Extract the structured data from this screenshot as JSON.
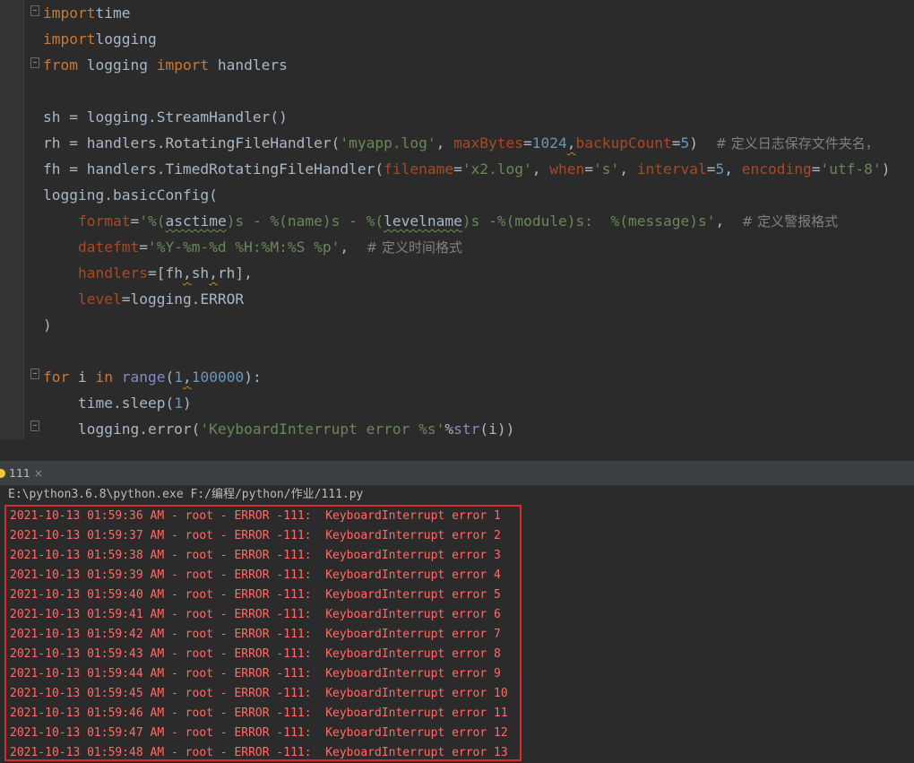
{
  "editor": {
    "code": [
      [
        [
          "kw",
          "import"
        ],
        [
          "",
          "time"
        ]
      ],
      [
        [
          "kw",
          "import"
        ],
        [
          "",
          "logging"
        ]
      ],
      [
        [
          "kw",
          "from"
        ],
        [
          "",
          " logging "
        ],
        [
          "kw",
          "import"
        ],
        [
          "",
          " handlers"
        ]
      ],
      [],
      [
        [
          "",
          "sh = logging.StreamHandler()"
        ]
      ],
      [
        [
          "",
          "rh = handlers.RotatingFileHandler("
        ],
        [
          "str",
          "'myapp.log'"
        ],
        [
          "",
          ", "
        ],
        [
          "param",
          "maxBytes"
        ],
        [
          "",
          "="
        ],
        [
          "num",
          "1024"
        ],
        [
          "warn",
          ","
        ],
        [
          "param",
          "backupCount"
        ],
        [
          "",
          "="
        ],
        [
          "num",
          "5"
        ],
        [
          "",
          ")  "
        ],
        [
          "cmt",
          "# 定义日志保存文件夹名，"
        ]
      ],
      [
        [
          "",
          "fh = handlers.TimedRotatingFileHandler("
        ],
        [
          "param",
          "filename"
        ],
        [
          "",
          "="
        ],
        [
          "str",
          "'x2.log'"
        ],
        [
          "",
          ", "
        ],
        [
          "param",
          "when"
        ],
        [
          "",
          "="
        ],
        [
          "str",
          "'s'"
        ],
        [
          "",
          ", "
        ],
        [
          "param",
          "interval"
        ],
        [
          "",
          "="
        ],
        [
          "num",
          "5"
        ],
        [
          "",
          ", "
        ],
        [
          "param",
          "encoding"
        ],
        [
          "",
          "="
        ],
        [
          "str",
          "'utf-8'"
        ],
        [
          "",
          ")"
        ]
      ],
      [
        [
          "",
          "logging.basicConfig("
        ]
      ],
      [
        [
          "",
          "    "
        ],
        [
          "param",
          "format"
        ],
        [
          "",
          "="
        ],
        [
          "str",
          "'%("
        ],
        [
          "wavy",
          "asctime"
        ],
        [
          "str",
          ")s - %(name)s - %("
        ],
        [
          "wavy",
          "levelname"
        ],
        [
          "str",
          ")s -%(module)s:  %(message)s'"
        ],
        [
          "",
          ",  "
        ],
        [
          "cmt",
          "# 定义警报格式"
        ]
      ],
      [
        [
          "",
          "    "
        ],
        [
          "param",
          "datefmt"
        ],
        [
          "",
          "="
        ],
        [
          "str",
          "'%Y-%m-%d %H:%M:%S %p'"
        ],
        [
          "",
          ",  "
        ],
        [
          "cmt",
          "# 定义时间格式"
        ]
      ],
      [
        [
          "",
          "    "
        ],
        [
          "param",
          "handlers"
        ],
        [
          "",
          "=[fh"
        ],
        [
          "warn",
          ","
        ],
        [
          "",
          "sh"
        ],
        [
          "warn",
          ","
        ],
        [
          "",
          "rh],"
        ]
      ],
      [
        [
          "",
          "    "
        ],
        [
          "param",
          "level"
        ],
        [
          "",
          "=logging.ERROR"
        ]
      ],
      [
        [
          "",
          ")"
        ]
      ],
      [],
      [
        [
          "kw",
          "for"
        ],
        [
          "",
          " i "
        ],
        [
          "kw",
          "in"
        ],
        [
          "",
          " "
        ],
        [
          "bi",
          "range"
        ],
        [
          "",
          "("
        ],
        [
          "num",
          "1"
        ],
        [
          "warn",
          ","
        ],
        [
          "num",
          "100000"
        ],
        [
          "",
          "):"
        ]
      ],
      [
        [
          "",
          "    time.sleep("
        ],
        [
          "num",
          "1"
        ],
        [
          "",
          ")"
        ]
      ],
      [
        [
          "",
          "    logging.error("
        ],
        [
          "str",
          "'KeyboardInterrupt error %s'"
        ],
        [
          "",
          "%"
        ],
        [
          "bi",
          "str"
        ],
        [
          "",
          "(i))"
        ]
      ]
    ]
  },
  "run": {
    "tab_label": "111",
    "close_glyph": "×",
    "command": "E:\\python3.6.8\\python.exe F:/编程/python/作业/111.py",
    "log_lines": [
      "2021-10-13 01:59:36 AM - root - ERROR -111:  KeyboardInterrupt error 1",
      "2021-10-13 01:59:37 AM - root - ERROR -111:  KeyboardInterrupt error 2",
      "2021-10-13 01:59:38 AM - root - ERROR -111:  KeyboardInterrupt error 3",
      "2021-10-13 01:59:39 AM - root - ERROR -111:  KeyboardInterrupt error 4",
      "2021-10-13 01:59:40 AM - root - ERROR -111:  KeyboardInterrupt error 5",
      "2021-10-13 01:59:41 AM - root - ERROR -111:  KeyboardInterrupt error 6",
      "2021-10-13 01:59:42 AM - root - ERROR -111:  KeyboardInterrupt error 7",
      "2021-10-13 01:59:43 AM - root - ERROR -111:  KeyboardInterrupt error 8",
      "2021-10-13 01:59:44 AM - root - ERROR -111:  KeyboardInterrupt error 9",
      "2021-10-13 01:59:45 AM - root - ERROR -111:  KeyboardInterrupt error 10",
      "2021-10-13 01:59:46 AM - root - ERROR -111:  KeyboardInterrupt error 11",
      "2021-10-13 01:59:47 AM - root - ERROR -111:  KeyboardInterrupt error 12",
      "2021-10-13 01:59:48 AM - root - ERROR -111:  KeyboardInterrupt error 13"
    ]
  },
  "colors": {
    "editor_bg": "#2b2b2b",
    "keyword": "#cc7832",
    "string": "#6a8759",
    "number": "#6897bb",
    "parameter": "#aa4926",
    "comment": "#808080",
    "error_text": "#ff6b68",
    "highlight_box": "#d52d2d"
  },
  "icons": {
    "fold_markers": "fold-icon",
    "run_tab": "python-run-icon"
  }
}
